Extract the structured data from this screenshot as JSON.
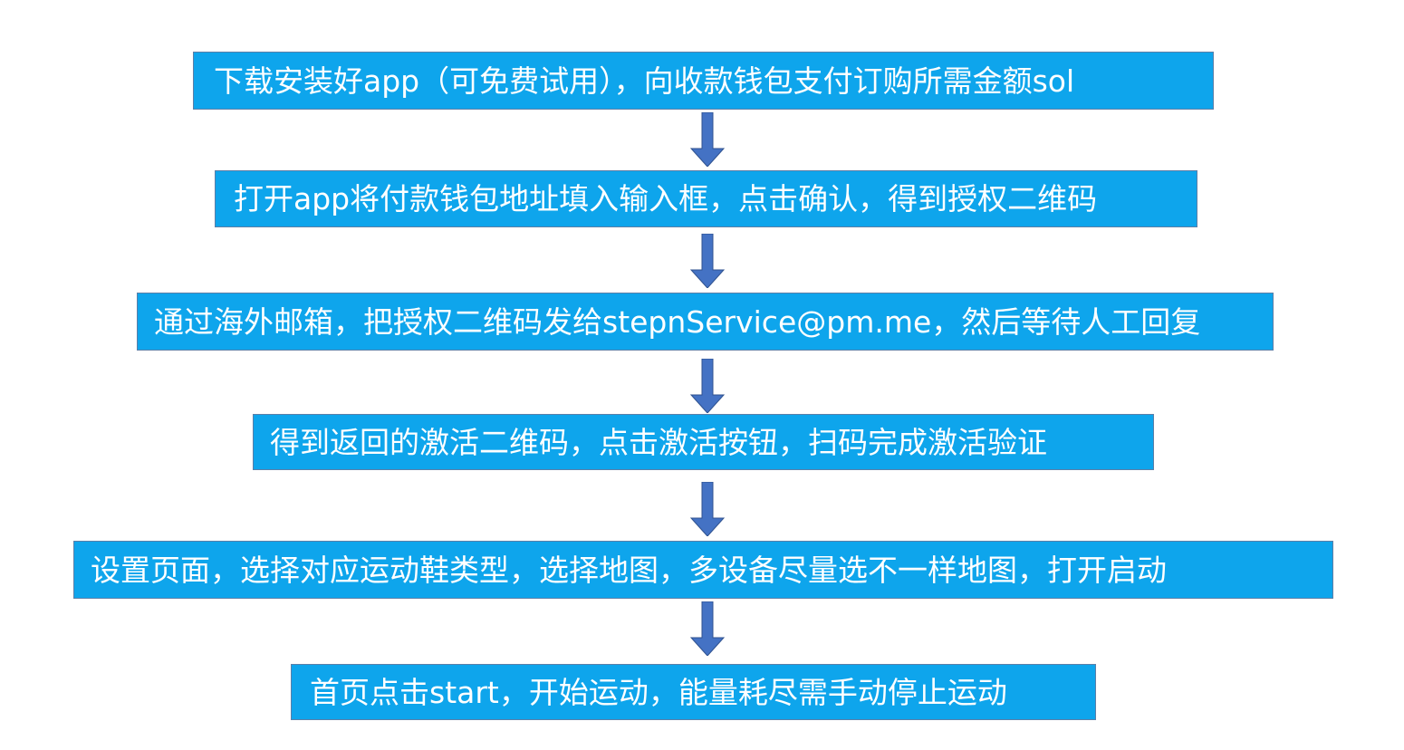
{
  "flow": {
    "steps": [
      "下载安装好app（可免费试用），向收款钱包支付订购所需金额sol",
      "打开app将付款钱包地址填入输入框，点击确认，得到授权二维码",
      "通过海外邮箱，把授权二维码发给stepnService@pm.me，然后等待人工回复",
      "得到返回的激活二维码，点击激活按钮，扫码完成激活验证",
      "设置页面，选择对应运动鞋类型，选择地图，多设备尽量选不一样地图，打开启动",
      "首页点击start，开始运动，能量耗尽需手动停止运动"
    ]
  },
  "colors": {
    "box_fill": "#0ea5ec",
    "box_border": "#5b7fa8",
    "arrow_fill": "#4472c4",
    "text": "#ffffff"
  }
}
